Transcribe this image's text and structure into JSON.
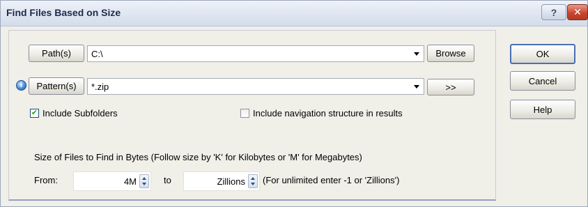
{
  "window": {
    "title": "Find Files Based on Size",
    "help_glyph": "?",
    "close_glyph": "✕"
  },
  "path": {
    "button_label": "Path(s)",
    "value": "C:\\",
    "browse_label": "Browse"
  },
  "pattern": {
    "button_label": "Pattern(s)",
    "value": "*.zip",
    "more_label": ">>",
    "info_glyph": "i"
  },
  "options": {
    "include_subfolders_label": "Include Subfolders",
    "include_subfolders_checked": true,
    "include_nav_label": "Include navigation structure in results",
    "include_nav_checked": false
  },
  "size": {
    "heading": "Size of Files to Find in Bytes  (Follow size by 'K' for Kilobytes or 'M' for Megabytes)",
    "from_label": "From:",
    "from_value": "4M",
    "to_label": "to",
    "to_value": "Zillions",
    "hint": "(For unlimited enter -1 or 'Zillions')"
  },
  "actions": {
    "ok_label": "OK",
    "cancel_label": "Cancel",
    "help_label": "Help"
  }
}
